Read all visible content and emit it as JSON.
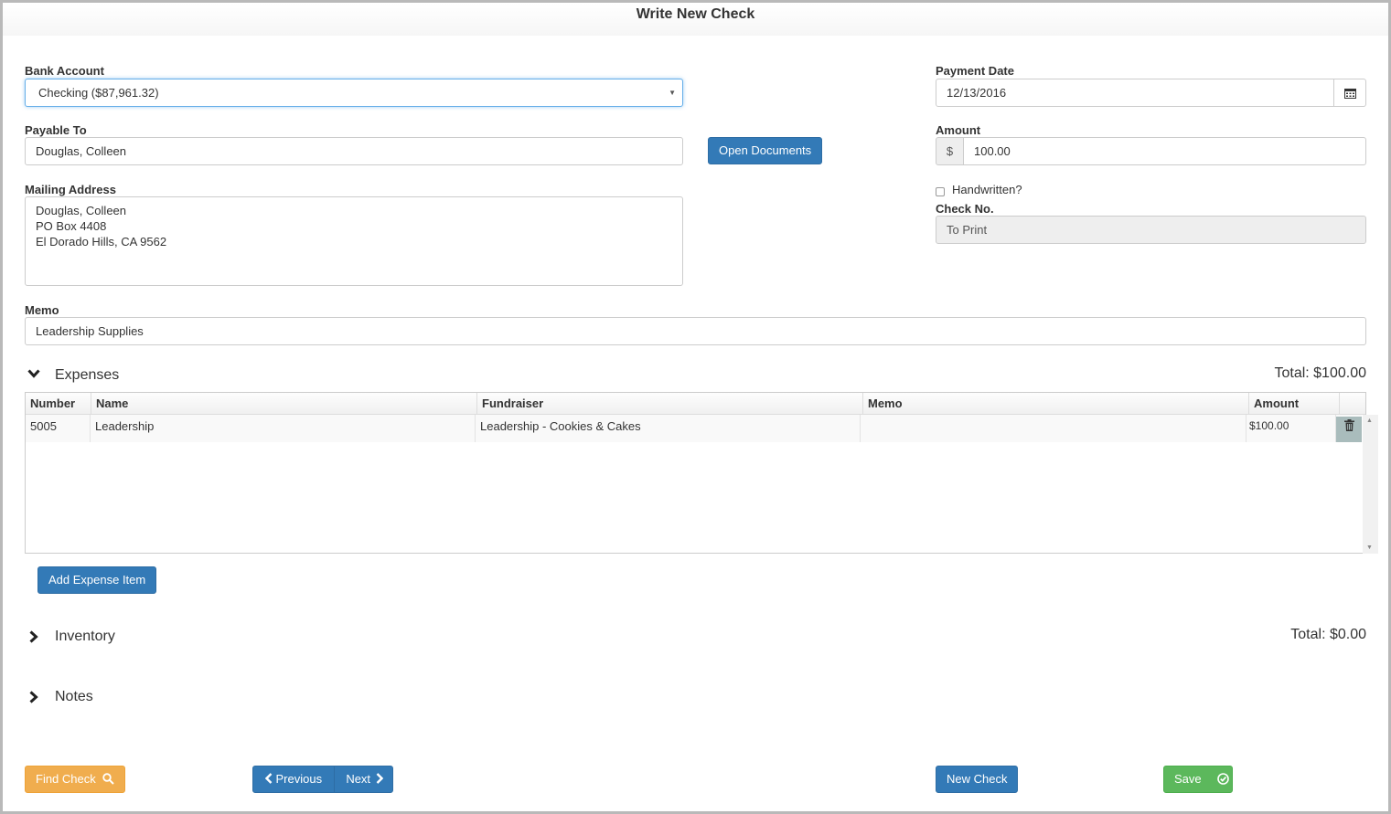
{
  "window": {
    "title": "Write New Check"
  },
  "form": {
    "bank_account_label": "Bank Account",
    "bank_account_value": "Checking ($87,961.32)",
    "payment_date_label": "Payment Date",
    "payment_date_value": "12/13/2016",
    "payable_to_label": "Payable To",
    "payable_to_value": "Douglas, Colleen",
    "open_documents_label": "Open Documents",
    "amount_label": "Amount",
    "amount_prefix": "$",
    "amount_value": "100.00",
    "mailing_address_label": "Mailing Address",
    "mailing_address_lines": [
      "Douglas, Colleen",
      "PO Box 4408",
      "El Dorado Hills, CA 9562"
    ],
    "handwritten_label": "Handwritten?",
    "handwritten_checked": false,
    "check_no_label": "Check No.",
    "check_no_value": "To Print",
    "memo_label": "Memo",
    "memo_value": "Leadership Supplies"
  },
  "expenses": {
    "title": "Expenses",
    "total": "Total: $100.00",
    "columns": [
      "Number",
      "Name",
      "Fundraiser",
      "Memo",
      "Amount"
    ],
    "rows": [
      {
        "number": "5005",
        "name": "Leadership",
        "fundraiser": "Leadership - Cookies & Cakes",
        "memo": "",
        "amount": "$100.00"
      }
    ],
    "add_button": "Add Expense Item"
  },
  "inventory": {
    "title": "Inventory",
    "total": "Total: $0.00"
  },
  "notes": {
    "title": "Notes"
  },
  "footer": {
    "find_check": "Find Check",
    "previous": "Previous",
    "next": "Next",
    "new_check": "New Check",
    "save": "Save"
  },
  "icons": {
    "calendar": "calendar-icon",
    "trash": "trash-icon",
    "search": "search-icon",
    "chevron_left": "chevron-left-icon",
    "chevron_right": "chevron-right-icon",
    "check_circle": "check-circle-icon"
  },
  "colors": {
    "primary": "#337ab7",
    "warning": "#f0ad4e",
    "success": "#5cb85c"
  }
}
